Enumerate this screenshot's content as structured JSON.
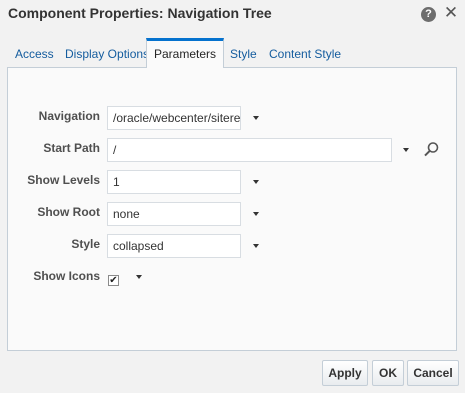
{
  "dialog": {
    "title": "Component Properties: Navigation Tree",
    "help_label": "?",
    "close_label": "✕"
  },
  "tabs": [
    {
      "label": "Access"
    },
    {
      "label": "Display Options"
    },
    {
      "label": "Parameters",
      "active": true
    },
    {
      "label": "Style"
    },
    {
      "label": "Content Style"
    }
  ],
  "params": {
    "navigation": {
      "label": "Navigation",
      "value": "/oracle/webcenter/siteresc"
    },
    "start_path": {
      "label": "Start Path",
      "value": "/"
    },
    "show_levels": {
      "label": "Show Levels",
      "value": "1"
    },
    "show_root": {
      "label": "Show Root",
      "value": "none"
    },
    "style": {
      "label": "Style",
      "value": "collapsed"
    },
    "show_icons": {
      "label": "Show Icons",
      "checked": true,
      "check_mark": "✔"
    }
  },
  "buttons": {
    "apply": "Apply",
    "ok": "OK",
    "cancel": "Cancel"
  },
  "icons": {
    "help": "help-icon",
    "close": "close-icon",
    "dropdown": "chevron-down-icon",
    "search": "search-icon"
  }
}
